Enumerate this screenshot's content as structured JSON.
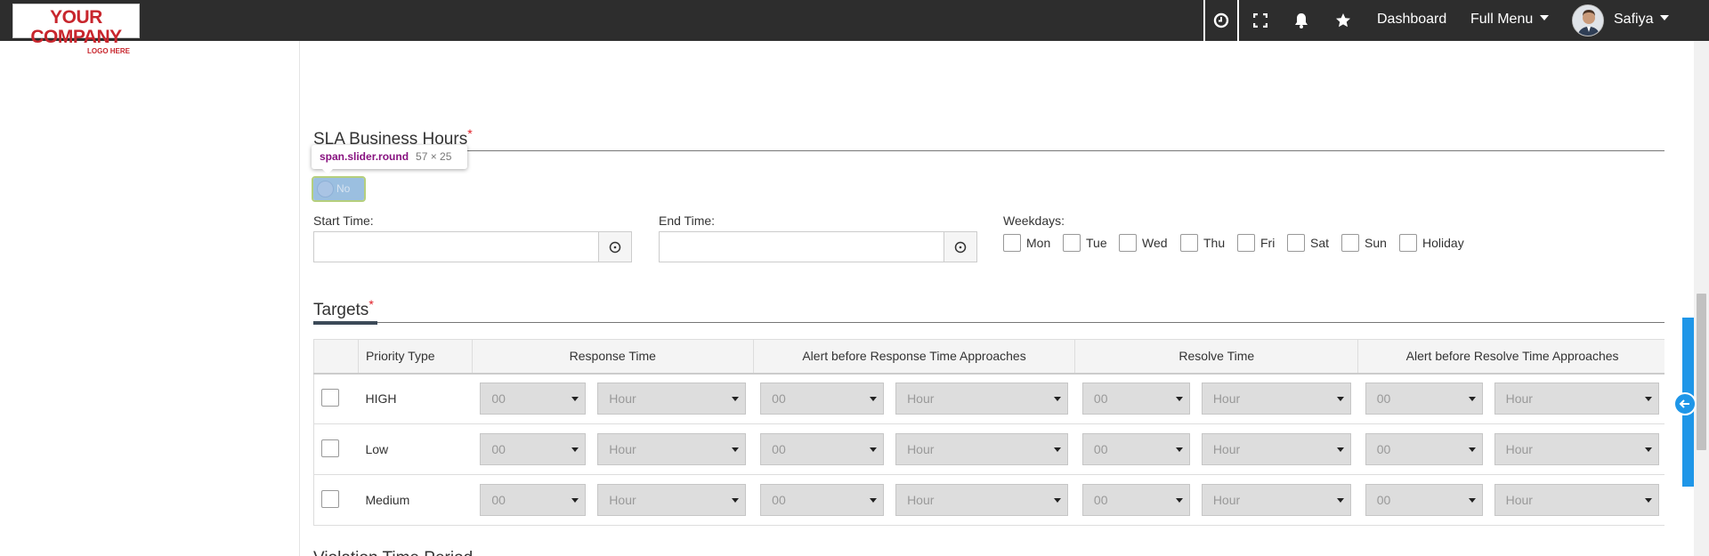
{
  "topbar": {
    "logo_line1": "YOUR COMPANY",
    "logo_line2": "LOGO HERE",
    "icons": [
      "clock-icon",
      "fullscreen-icon",
      "bell-icon",
      "star-icon"
    ],
    "dashboard_label": "Dashboard",
    "full_menu_label": "Full Menu",
    "user_name": "Safiya",
    "bg_color": "#2d2d2d"
  },
  "sla": {
    "title": "SLA Business Hours",
    "required_mark": "*",
    "tooltip_selector": "span.slider.round",
    "tooltip_dims": "57 × 25",
    "toggle_label": "No",
    "start_time_label": "Start Time:",
    "start_time_value": "",
    "end_time_label": "End Time:",
    "end_time_value": "",
    "weekdays_label": "Weekdays:",
    "weekdays": [
      "Mon",
      "Tue",
      "Wed",
      "Thu",
      "Fri",
      "Sat",
      "Sun",
      "Holiday"
    ]
  },
  "targets": {
    "title": "Targets",
    "required_mark": "*",
    "headers": [
      "",
      "Priority Type",
      "Response Time",
      "Alert before Response Time Approaches",
      "Resolve Time",
      "Alert before Resolve Time Approaches"
    ],
    "rows": [
      {
        "priority": "HIGH",
        "values": [
          "00",
          "Hour",
          "00",
          "Hour",
          "00",
          "Hour",
          "00",
          "Hour"
        ]
      },
      {
        "priority": "Low",
        "values": [
          "00",
          "Hour",
          "00",
          "Hour",
          "00",
          "Hour",
          "00",
          "Hour"
        ]
      },
      {
        "priority": "Medium",
        "values": [
          "00",
          "Hour",
          "00",
          "Hour",
          "00",
          "Hour",
          "00",
          "Hour"
        ]
      }
    ]
  },
  "next_section_title": "Violation Time Period",
  "accent_color": "#1e96e8"
}
